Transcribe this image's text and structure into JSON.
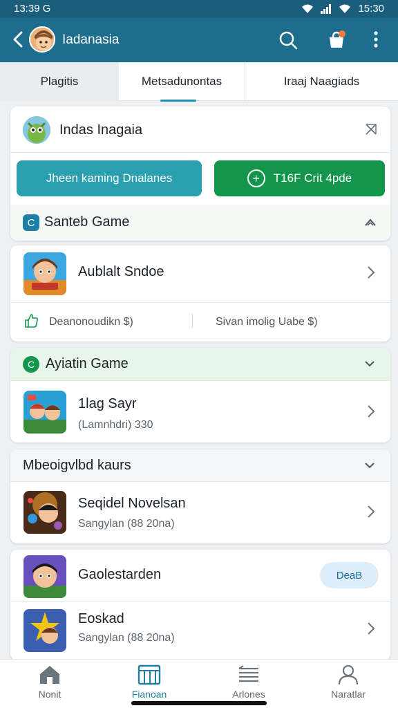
{
  "status": {
    "time": "13:39 G",
    "right_time": "15:30"
  },
  "appbar": {
    "title": "Iadanasia"
  },
  "tabs": [
    {
      "label": "Plagitis"
    },
    {
      "label": "Metsadunontas"
    },
    {
      "label": "Iraaj Naagiads"
    }
  ],
  "card1": {
    "title": "Indas Inagaia",
    "btn_primary": "Jheen kaming Dnalanes",
    "btn_secondary": "T16F Crit 4pde",
    "section_label": "Santeb Game"
  },
  "card2": {
    "title": "Aublalt Sndoe",
    "stat_left": "Deanonoudikn $)",
    "stat_right": "Sivan imolig Uabe $)"
  },
  "card3": {
    "section_label": "Ayiatin Game",
    "item_title": "1lag Sayr",
    "item_sub": "(Lamnhdri) 330"
  },
  "card4": {
    "section_label": "Mbeoigvlbd kaurs",
    "item_title": "Seqidel Novelsan",
    "item_sub": "Sangylan (88 20na)"
  },
  "card5": {
    "item1_title": "Gaolestarden",
    "pill_label": "DeaB",
    "item2_title": "Eoskad",
    "item2_sub": "Sangylan (88 20na)"
  },
  "bottom_nav": [
    {
      "label": "Nonit"
    },
    {
      "label": "Fianoan"
    },
    {
      "label": "Arlones"
    },
    {
      "label": "Naratlar"
    }
  ],
  "colors": {
    "appbar": "#1d6e8e",
    "accent": "#1d8fb0",
    "teal_button": "#2a9fae",
    "green_button": "#14954c"
  }
}
